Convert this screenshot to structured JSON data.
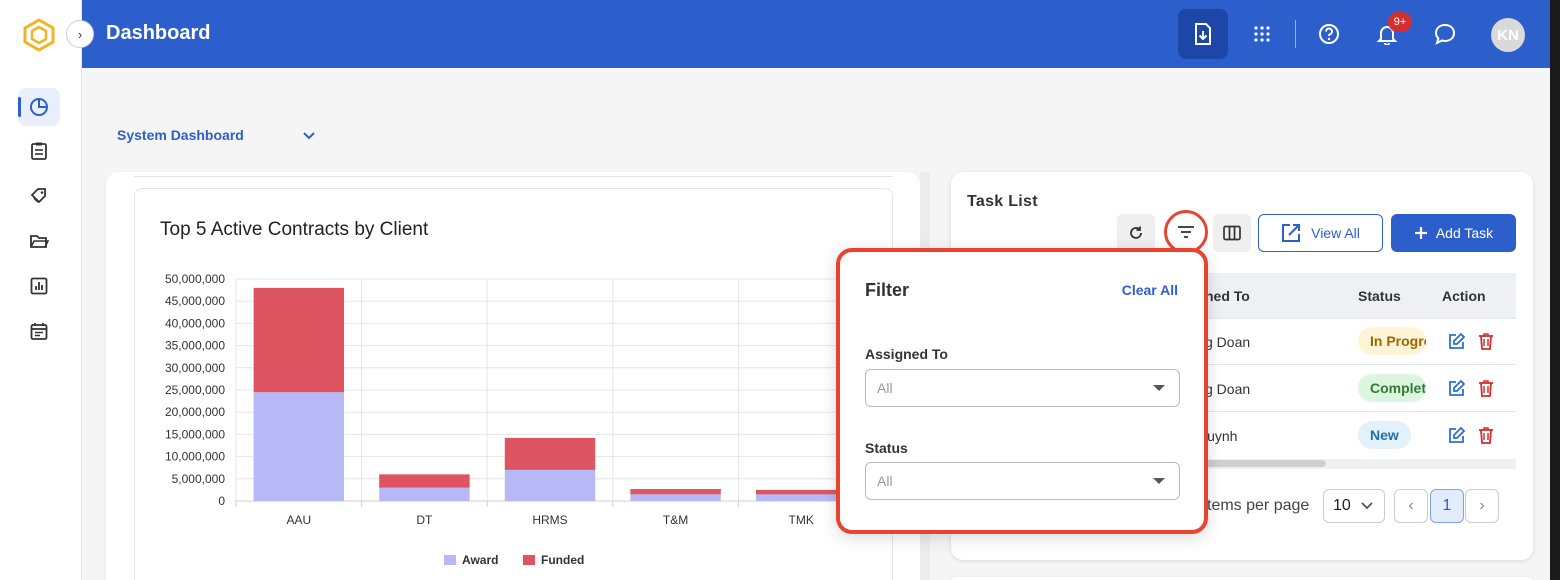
{
  "header": {
    "title": "Dashboard",
    "notification_count": "9+",
    "avatar_initials": "KN"
  },
  "sidebar": {
    "items": [
      {
        "name": "dashboard",
        "icon": "pie-chart-icon",
        "active": true
      },
      {
        "name": "contracts",
        "icon": "clipboard-icon"
      },
      {
        "name": "tags",
        "icon": "tags-icon"
      },
      {
        "name": "folders",
        "icon": "folder-open-icon"
      },
      {
        "name": "reports",
        "icon": "bar-report-icon"
      },
      {
        "name": "calendar",
        "icon": "calendar-icon"
      }
    ]
  },
  "dashboard_selector": {
    "value": "System Dashboard"
  },
  "chart_data": {
    "type": "bar",
    "stacked": true,
    "title": "Top 5 Active Contracts by Client",
    "categories": [
      "AAU",
      "DT",
      "HRMS",
      "T&M",
      "TMK"
    ],
    "series": [
      {
        "name": "Award",
        "color": "#b7b9f7",
        "values": [
          24500000,
          3000000,
          7000000,
          1500000,
          1500000
        ]
      },
      {
        "name": "Funded",
        "color": "#de5461",
        "values": [
          23500000,
          3000000,
          7200000,
          1200000,
          1000000
        ]
      }
    ],
    "ylim": [
      0,
      50000000
    ],
    "yticks": [
      "0",
      "5,000,000",
      "10,000,000",
      "15,000,000",
      "20,000,000",
      "25,000,000",
      "30,000,000",
      "35,000,000",
      "40,000,000",
      "45,000,000",
      "50,000,000"
    ],
    "grid": true,
    "legend": "bottom"
  },
  "task_list": {
    "title": "Task List",
    "view_all_label": "View All",
    "add_task_label": "Add Task",
    "columns": [
      "ned To",
      "Status",
      "Action"
    ],
    "rows": [
      {
        "assigned": "g Doan",
        "status": "In Progress",
        "status_kind": "progress"
      },
      {
        "assigned": "g Doan",
        "status": "Completed",
        "status_kind": "complete"
      },
      {
        "assigned": "Huynh",
        "status": "New",
        "status_kind": "new"
      }
    ],
    "items_per_page_label": "tems per page",
    "items_per_page": "10",
    "current_page": "1"
  },
  "filter": {
    "title": "Filter",
    "clear_all_label": "Clear All",
    "assigned_to_label": "Assigned To",
    "assigned_to_value": "All",
    "status_label": "Status",
    "status_value": "All"
  },
  "colors": {
    "brand": "#2d5fcc",
    "highlight": "#e8432e"
  }
}
